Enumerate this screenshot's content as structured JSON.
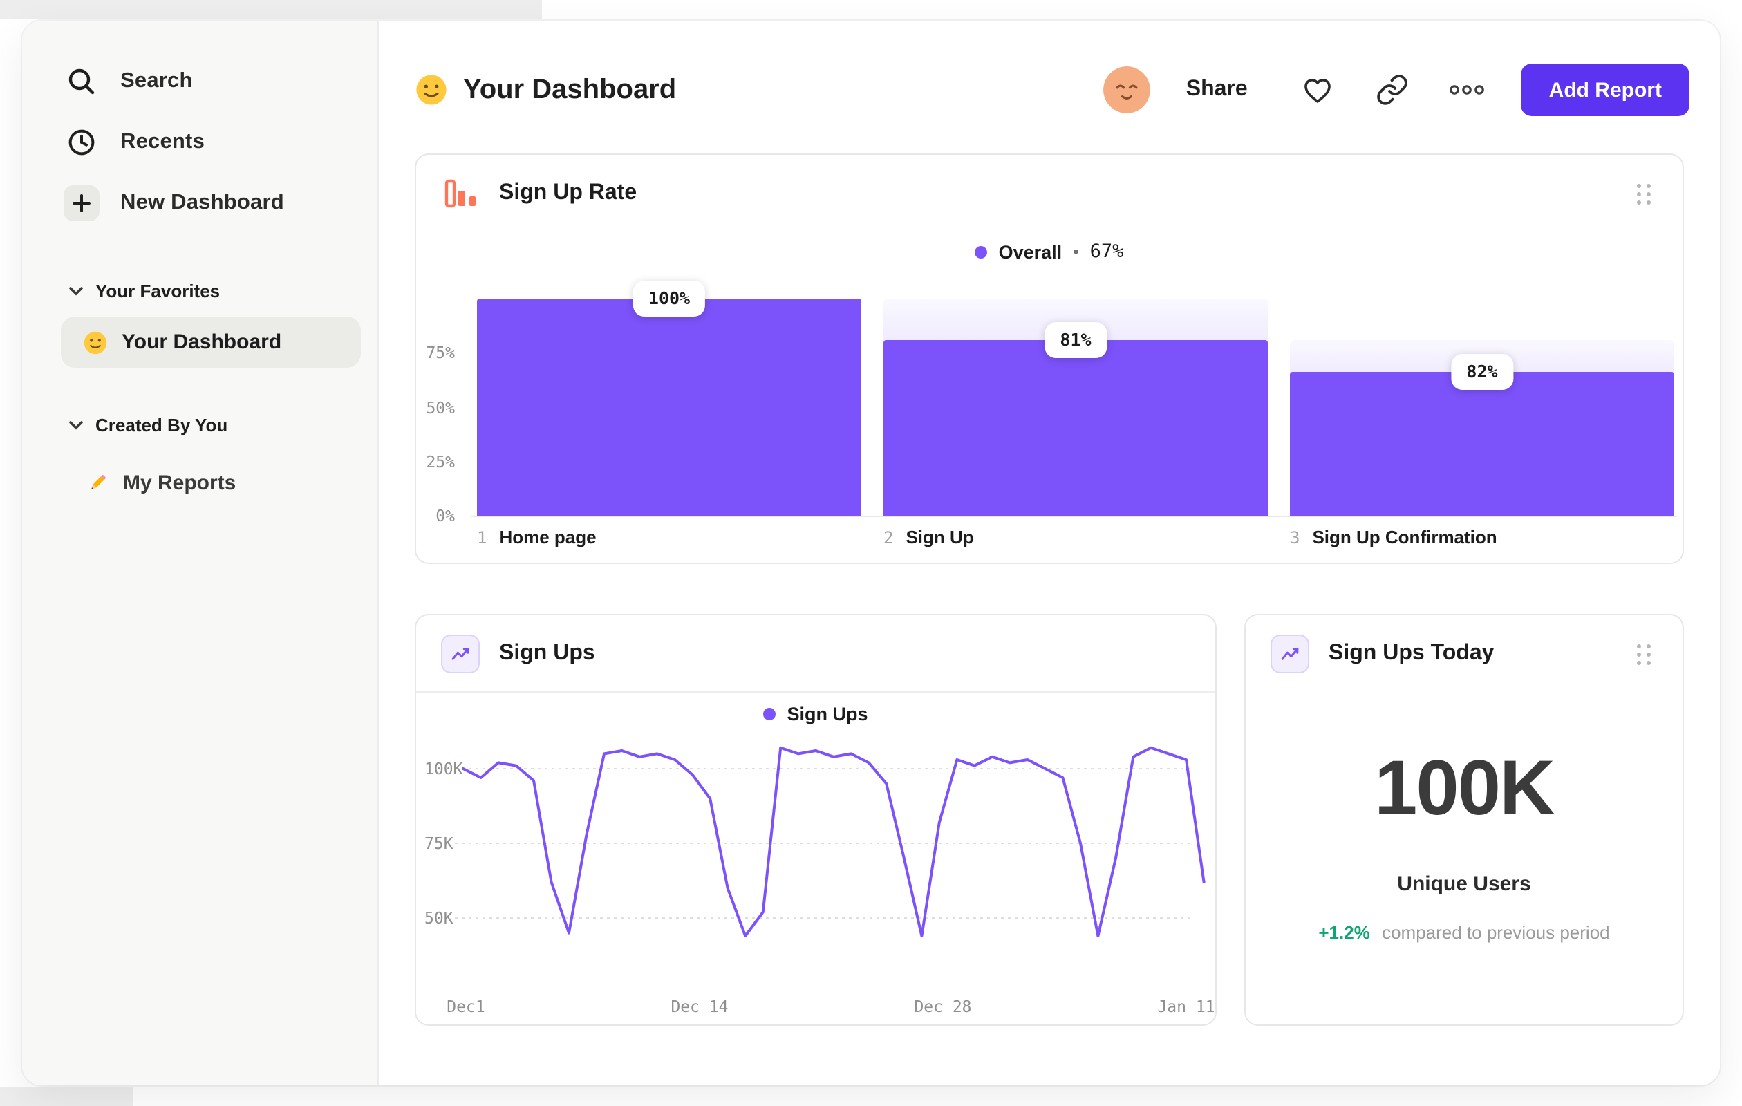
{
  "colors": {
    "accent_purple": "#7C52FA",
    "button_purple": "#5C33F0",
    "icon_orange": "#FF7557",
    "positive_green": "#0FA573",
    "sidebar_bg": "#F8F8F6"
  },
  "sidebar": {
    "items": [
      {
        "label": "Search",
        "icon": "search-icon"
      },
      {
        "label": "Recents",
        "icon": "clock-icon"
      },
      {
        "label": "New Dashboard",
        "icon": "plus-icon"
      }
    ],
    "sections": [
      {
        "title": "Your Favorites",
        "items": [
          {
            "label": "Your Dashboard",
            "icon": "smiley-emoji",
            "active": true
          }
        ]
      },
      {
        "title": "Created By You",
        "items": [
          {
            "label": "My Reports",
            "icon": "pencil-emoji",
            "active": false
          }
        ]
      }
    ]
  },
  "header": {
    "title": "Your Dashboard",
    "share_label": "Share",
    "add_report_label": "Add Report"
  },
  "funnel_card": {
    "title": "Sign Up Rate",
    "legend_name": "Overall",
    "legend_sep": "•",
    "legend_value": "67%",
    "y_ticks": [
      "75%",
      "50%",
      "25%",
      "0%"
    ],
    "steps": [
      {
        "num": "1",
        "label": "Home page",
        "conversion": "100%",
        "height_pct": 100,
        "prev_pct": 100
      },
      {
        "num": "2",
        "label": "Sign Up",
        "conversion": "81%",
        "height_pct": 81,
        "prev_pct": 100
      },
      {
        "num": "3",
        "label": "Sign Up Confirmation",
        "conversion": "82%",
        "height_pct": 66.4,
        "prev_pct": 81
      }
    ]
  },
  "line_card": {
    "title": "Sign Ups",
    "legend_name": "Sign Ups",
    "y_ticks": [
      "100K",
      "75K",
      "50K"
    ],
    "x_ticks": [
      "Dec1",
      "Dec 14",
      "Dec 28",
      "Jan 11"
    ]
  },
  "metric_card": {
    "title": "Sign Ups Today",
    "value": "100K",
    "label": "Unique Users",
    "delta": "+1.2%",
    "delta_note": "compared to previous period"
  },
  "chart_data": [
    {
      "type": "bar",
      "variant": "funnel",
      "title": "Sign Up Rate",
      "legend": "Overall • 67%",
      "categories": [
        "1 Home page",
        "2 Sign Up",
        "3 Sign Up Confirmation"
      ],
      "values": [
        100,
        81,
        66.4
      ],
      "value_labels": [
        "100%",
        "81%",
        "82%"
      ],
      "note": "value_labels are per-step conversion rates; bar heights are % of first step; faded gradient above bars 2-3 marks drop-off from previous step",
      "ylim": [
        0,
        100
      ],
      "y_ticks_pct": [
        75,
        50,
        25,
        0
      ]
    },
    {
      "type": "line",
      "title": "Sign Ups",
      "series": [
        {
          "name": "Sign Ups",
          "values_k": [
            100,
            97,
            102,
            101,
            96,
            62,
            45,
            78,
            105,
            106,
            104,
            105,
            103,
            98,
            90,
            60,
            44,
            52,
            107,
            105,
            106,
            104,
            105,
            102,
            95,
            70,
            44,
            82,
            103,
            101,
            104,
            102,
            103,
            100,
            97,
            75,
            44,
            70,
            104,
            107,
            105,
            103,
            62
          ]
        }
      ],
      "x_ticks": [
        "Dec1",
        "Dec 14",
        "Dec 28",
        "Jan 11"
      ],
      "x_range_days": 41,
      "y_ticks_k": [
        100,
        75,
        50
      ],
      "ylim_k": [
        30,
        115
      ],
      "unit": "K users per day",
      "legend_position": "top-center",
      "grid": "horizontal-dashed"
    },
    {
      "type": "metric",
      "title": "Sign Ups Today",
      "value": "100K",
      "label": "Unique Users",
      "delta_pct": 1.2,
      "comparison": "compared to previous period"
    }
  ]
}
